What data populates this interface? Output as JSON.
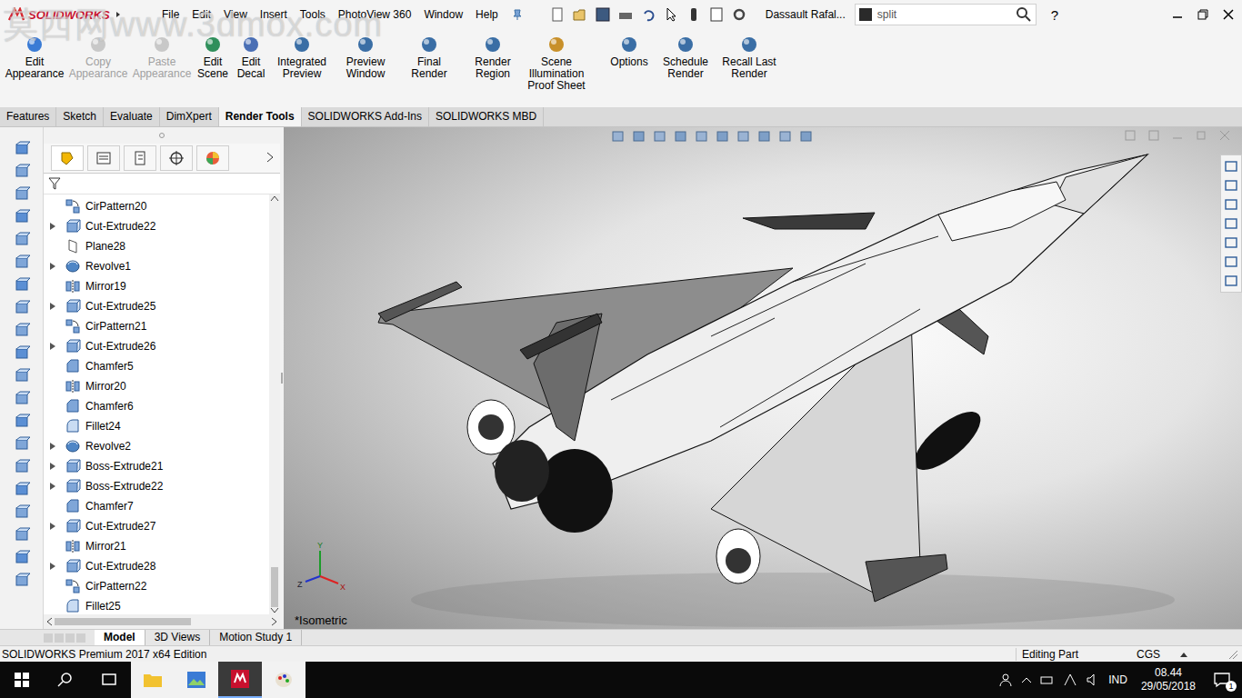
{
  "app": {
    "logo": "SOLIDWORKS",
    "watermark": "莫西网www.3dmox.com",
    "document_title": "Dassault Rafal...",
    "search": {
      "value": "split"
    },
    "help": "?"
  },
  "menu": [
    "File",
    "Edit",
    "View",
    "Insert",
    "Tools",
    "PhotoView 360",
    "Window",
    "Help"
  ],
  "ribbon": [
    {
      "label": "Edit Appearance",
      "disabled": false
    },
    {
      "label": "Copy Appearance",
      "disabled": true
    },
    {
      "label": "Paste Appearance",
      "disabled": true
    },
    {
      "label": "Edit Scene",
      "disabled": false
    },
    {
      "label": "Edit Decal",
      "disabled": false
    },
    {
      "label": "Integrated Preview",
      "disabled": false
    },
    {
      "label": "Preview Window",
      "disabled": false
    },
    {
      "label": "Final Render",
      "disabled": false
    },
    {
      "label": "Render Region",
      "disabled": false
    },
    {
      "label": "Scene Illumination Proof Sheet",
      "disabled": false
    },
    {
      "label": "Options",
      "disabled": false
    },
    {
      "label": "Schedule Render",
      "disabled": false
    },
    {
      "label": "Recall Last Render",
      "disabled": false
    }
  ],
  "tabs": [
    {
      "label": "Features",
      "selected": false
    },
    {
      "label": "Sketch",
      "selected": false
    },
    {
      "label": "Evaluate",
      "selected": false
    },
    {
      "label": "DimXpert",
      "selected": false
    },
    {
      "label": "Render Tools",
      "selected": true
    },
    {
      "label": "SOLIDWORKS Add-Ins",
      "selected": false
    },
    {
      "label": "SOLIDWORKS MBD",
      "selected": false
    }
  ],
  "tree": {
    "items": [
      {
        "name": "CirPattern20",
        "kind": "pattern",
        "expandable": false
      },
      {
        "name": "Cut-Extrude22",
        "kind": "extrude",
        "expandable": true
      },
      {
        "name": "Plane28",
        "kind": "plane",
        "expandable": false
      },
      {
        "name": "Revolve1",
        "kind": "revolve",
        "expandable": true
      },
      {
        "name": "Mirror19",
        "kind": "mirror",
        "expandable": false
      },
      {
        "name": "Cut-Extrude25",
        "kind": "extrude",
        "expandable": true
      },
      {
        "name": "CirPattern21",
        "kind": "pattern",
        "expandable": false
      },
      {
        "name": "Cut-Extrude26",
        "kind": "extrude",
        "expandable": true
      },
      {
        "name": "Chamfer5",
        "kind": "chamfer",
        "expandable": false
      },
      {
        "name": "Mirror20",
        "kind": "mirror",
        "expandable": false
      },
      {
        "name": "Chamfer6",
        "kind": "chamfer",
        "expandable": false
      },
      {
        "name": "Fillet24",
        "kind": "fillet",
        "expandable": false
      },
      {
        "name": "Revolve2",
        "kind": "revolve",
        "expandable": true
      },
      {
        "name": "Boss-Extrude21",
        "kind": "extrude",
        "expandable": true
      },
      {
        "name": "Boss-Extrude22",
        "kind": "extrude",
        "expandable": true
      },
      {
        "name": "Chamfer7",
        "kind": "chamfer",
        "expandable": false
      },
      {
        "name": "Cut-Extrude27",
        "kind": "extrude",
        "expandable": true
      },
      {
        "name": "Mirror21",
        "kind": "mirror",
        "expandable": false
      },
      {
        "name": "Cut-Extrude28",
        "kind": "extrude",
        "expandable": true
      },
      {
        "name": "CirPattern22",
        "kind": "pattern",
        "expandable": false
      },
      {
        "name": "Fillet25",
        "kind": "fillet",
        "expandable": false
      }
    ]
  },
  "panel_tabs": [
    {
      "label": "Model",
      "selected": true
    },
    {
      "label": "3D Views",
      "selected": false
    },
    {
      "label": "Motion Study 1",
      "selected": false
    }
  ],
  "viewport": {
    "view_label": "*Isometric",
    "axes": [
      "Y",
      "Z",
      "X"
    ]
  },
  "status_bar": {
    "product": "SOLIDWORKS Premium 2017 x64 Edition",
    "mode": "Editing Part",
    "units": "CGS"
  },
  "taskbar": {
    "language": "IND",
    "time": "08.44",
    "date": "29/05/2018",
    "notifications": "1"
  }
}
